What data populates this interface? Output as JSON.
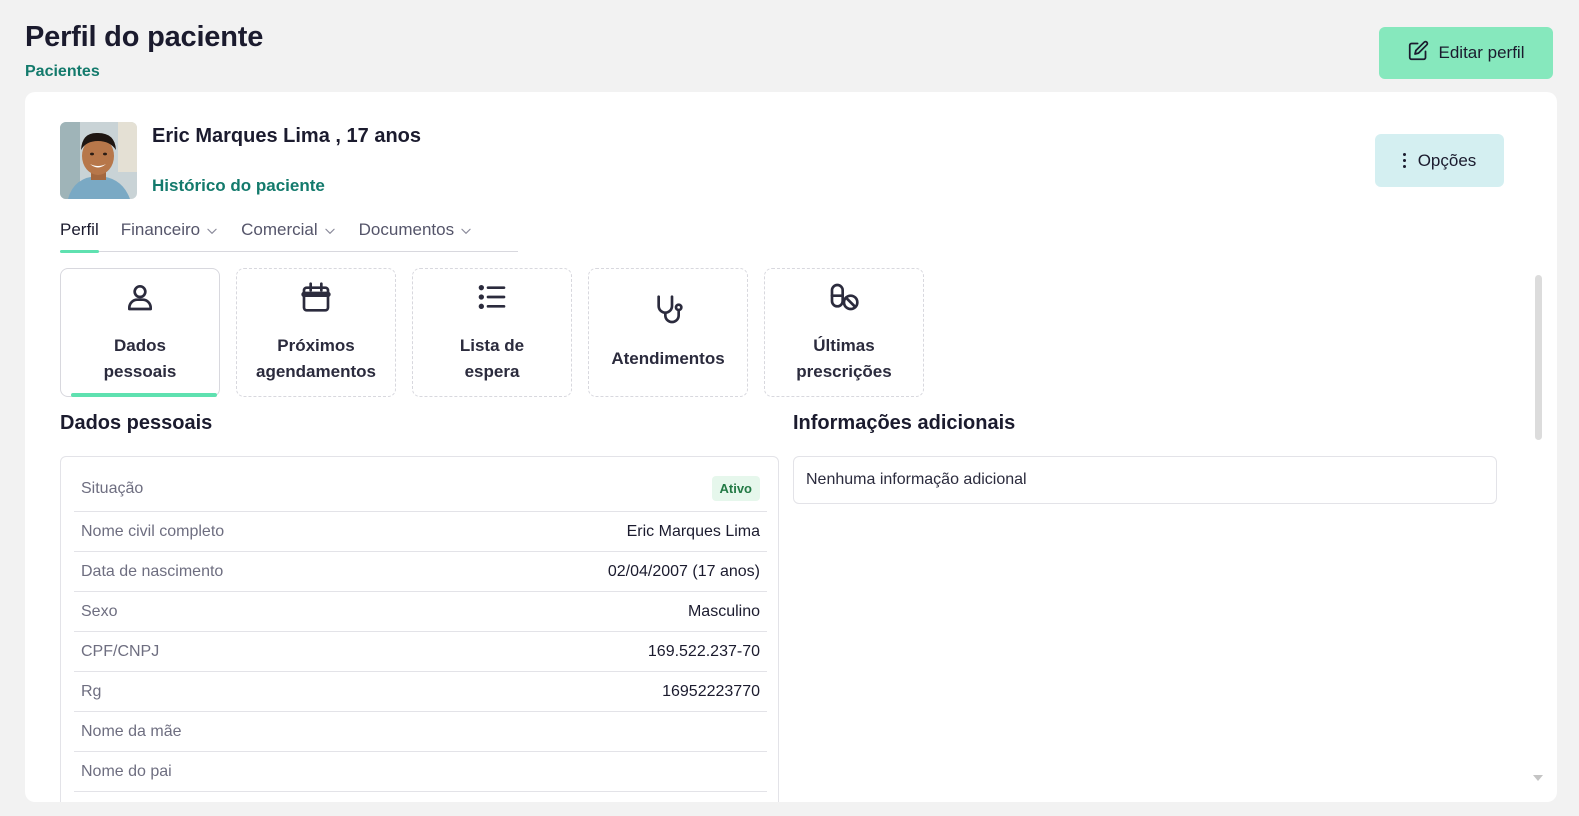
{
  "header": {
    "title": "Perfil do paciente",
    "breadcrumb": "Pacientes",
    "edit_label": "Editar perfil"
  },
  "patient": {
    "name_line": "Eric Marques Lima , 17 anos",
    "history_link": "Histórico do paciente",
    "options_label": "Opções"
  },
  "tabs": [
    {
      "label": "Perfil",
      "active": true
    },
    {
      "label": "Financeiro"
    },
    {
      "label": "Comercial"
    },
    {
      "label": "Documentos"
    }
  ],
  "tiles": [
    {
      "icon": "user-icon",
      "label": "Dados\npessoais"
    },
    {
      "icon": "calendar-icon",
      "label": "Próximos\nagendamentos"
    },
    {
      "icon": "list-icon",
      "label": "Lista de\nespera"
    },
    {
      "icon": "stethoscope-icon",
      "label": "Atendimentos"
    },
    {
      "icon": "medication-off-icon",
      "label": "Últimas\nprescrições"
    }
  ],
  "personal": {
    "title": "Dados pessoais",
    "rows": [
      {
        "key": "Situação",
        "badge": "Ativo"
      },
      {
        "key": "Nome civil completo",
        "value": "Eric Marques Lima"
      },
      {
        "key": "Data de nascimento",
        "value": "02/04/2007 (17 anos)"
      },
      {
        "key": "Sexo",
        "value": "Masculino"
      },
      {
        "key": "CPF/CNPJ",
        "value": "169.522.237-70"
      },
      {
        "key": "Rg",
        "value": "16952223770"
      },
      {
        "key": "Nome da mãe",
        "value": ""
      },
      {
        "key": "Nome do pai",
        "value": ""
      }
    ]
  },
  "additional": {
    "title": "Informações adicionais",
    "empty_text": "Nenhuma informação adicional"
  },
  "colors": {
    "accent": "#137a6c",
    "primary_button": "#86e8bd",
    "options_button": "#d4eff1",
    "active_indicator": "#5fe1b0"
  }
}
